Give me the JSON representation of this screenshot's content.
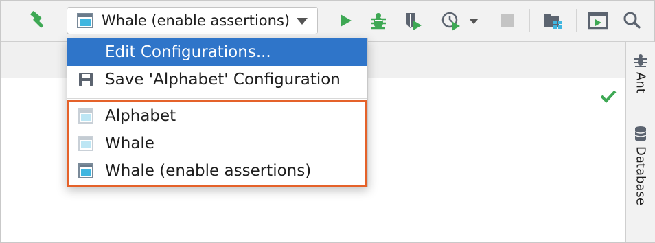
{
  "toolbar": {
    "run_config_selected": "Whale (enable assertions)",
    "icons": [
      "build-hammer-icon",
      "run-icon",
      "debug-bug-icon",
      "coverage-icon",
      "profile-icon",
      "profile-dropdown-icon",
      "stop-icon",
      "project-structure-icon",
      "run-anything-icon",
      "search-icon"
    ]
  },
  "menu": {
    "actions": [
      {
        "label": "Edit Configurations...",
        "selected": true
      },
      {
        "label": "Save 'Alphabet' Configuration",
        "icon": "save-icon"
      }
    ],
    "configurations": [
      {
        "label": "Alphabet",
        "icon": "application-config-icon"
      },
      {
        "label": "Whale",
        "icon": "application-config-icon"
      },
      {
        "label": "Whale (enable assertions)",
        "icon": "application-config-icon"
      }
    ]
  },
  "sidebar": {
    "tools": [
      {
        "label": "Ant",
        "icon": "ant-icon"
      },
      {
        "label": "Database",
        "icon": "database-icon"
      }
    ]
  },
  "colors": {
    "accent_green": "#3ea854",
    "selection_blue": "#2f75c9",
    "highlight_orange": "#e5622a"
  }
}
